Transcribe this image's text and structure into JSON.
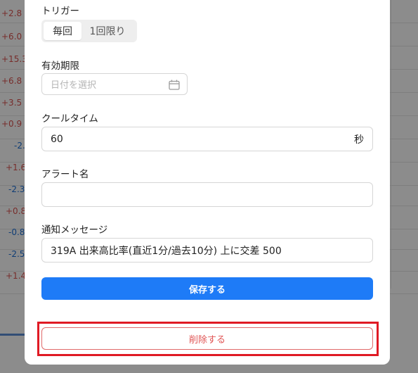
{
  "background": {
    "values": [
      "+2.8",
      "+6.0",
      "+15.3",
      "+6.8",
      "+3.5",
      "+0.9",
      "-2.",
      "+1.6",
      "-2.3",
      "+0.8",
      "-0.8",
      "-2.5",
      "+1.4"
    ]
  },
  "form": {
    "trigger": {
      "label": "トリガー",
      "options": [
        "毎回",
        "1回限り"
      ],
      "selected": "毎回"
    },
    "expiry": {
      "label": "有効期限",
      "placeholder": "日付を選択"
    },
    "cooltime": {
      "label": "クールタイム",
      "value": "60",
      "unit": "秒"
    },
    "alert_name": {
      "label": "アラート名",
      "value": ""
    },
    "message": {
      "label": "通知メッセージ",
      "value": "319A 出来高比率(直近1分/過去10分) 上に交差 500"
    },
    "save_label": "保存する",
    "delete_label": "削除する"
  },
  "colors": {
    "primary": "#1e7bf7",
    "danger": "#e05454",
    "highlight": "#e01a24",
    "positive": "#d9534f",
    "negative": "#1d6fd6"
  }
}
